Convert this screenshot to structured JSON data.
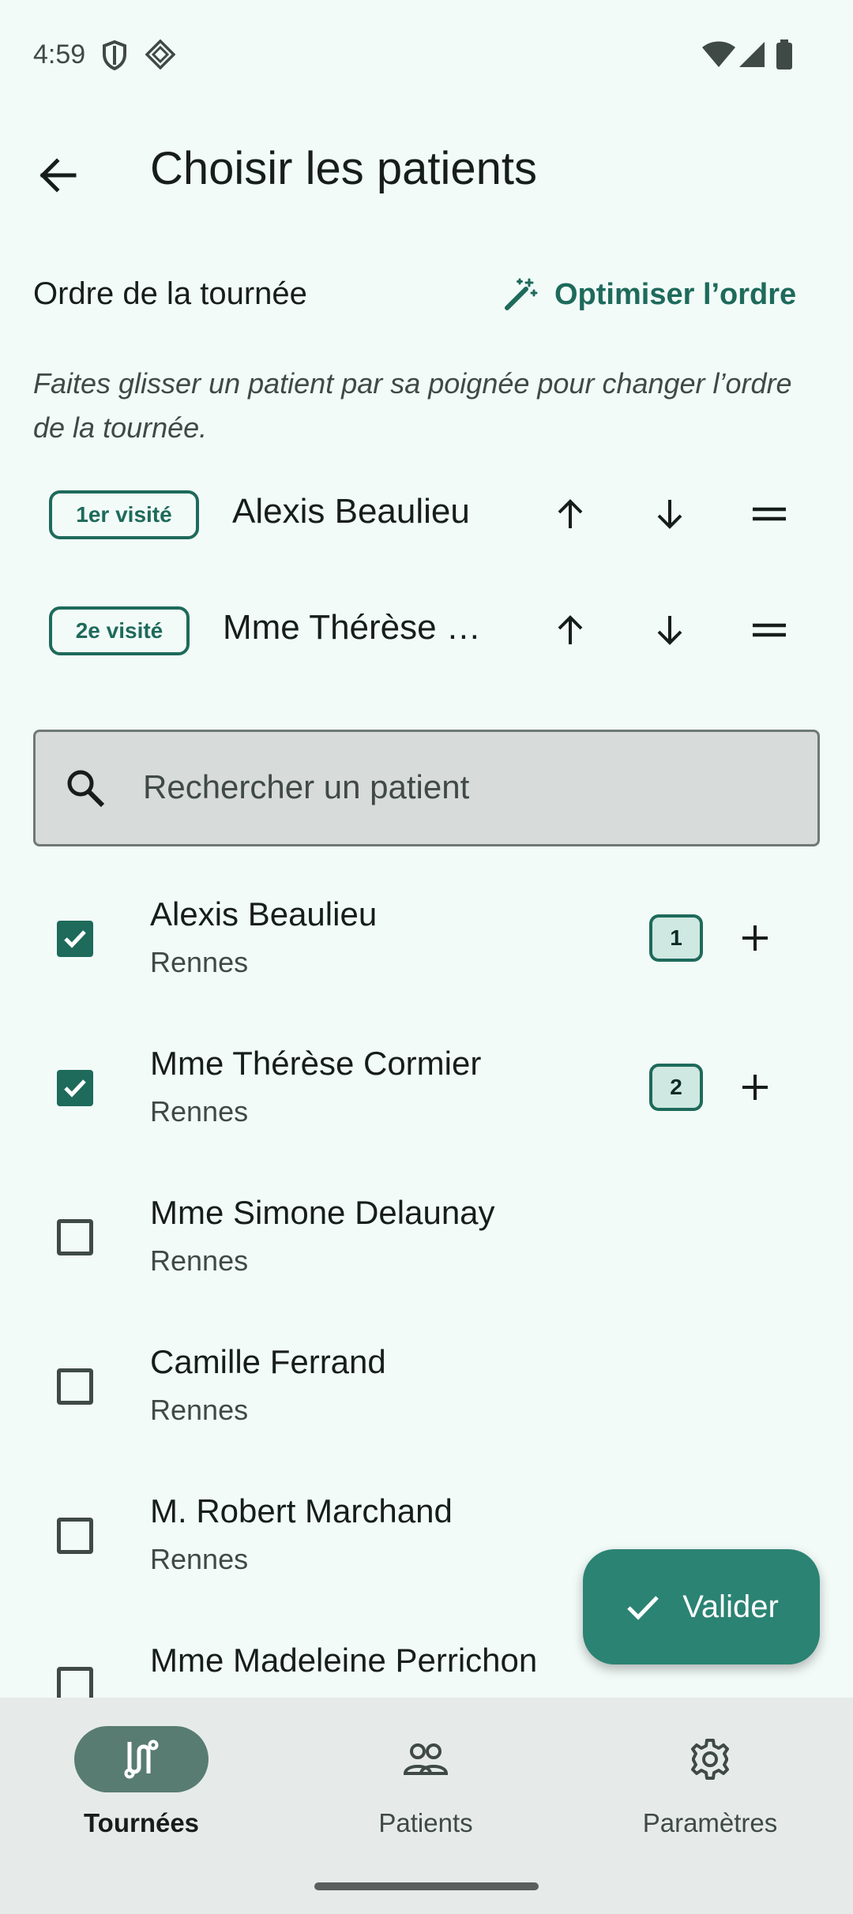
{
  "status_bar": {
    "time": "4:59"
  },
  "app_bar": {
    "title": "Choisir les patients"
  },
  "order_section": {
    "title": "Ordre de la tournée",
    "optimize_label": "Optimiser l’ordre",
    "hint": "Faites glisser un patient par sa poignée pour changer l’ordre de la tournée.",
    "items": [
      {
        "badge": "1er visité",
        "name": "Alexis Beaulieu"
      },
      {
        "badge": "2e visité",
        "name": "Mme Thérèse …"
      }
    ]
  },
  "search": {
    "placeholder": "Rechercher un patient"
  },
  "patients": [
    {
      "name": "Alexis Beaulieu",
      "city": "Rennes",
      "checked": true,
      "order": "1"
    },
    {
      "name": "Mme Thérèse Cormier",
      "city": "Rennes",
      "checked": true,
      "order": "2"
    },
    {
      "name": "Mme Simone Delaunay",
      "city": "Rennes",
      "checked": false
    },
    {
      "name": "Camille Ferrand",
      "city": "Rennes",
      "checked": false
    },
    {
      "name": "M. Robert Marchand",
      "city": "Rennes",
      "checked": false
    },
    {
      "name": "Mme Madeleine Perrichon",
      "city": "",
      "checked": false
    }
  ],
  "fab": {
    "label": "Valider"
  },
  "bottom_nav": [
    {
      "label": "Tournées",
      "icon": "route-icon",
      "active": true
    },
    {
      "label": "Patients",
      "icon": "people-icon",
      "active": false
    },
    {
      "label": "Paramètres",
      "icon": "gear-icon",
      "active": false
    }
  ],
  "colors": {
    "accent": "#1e6a5b",
    "fab": "#2b8373",
    "background": "#f2fbf8"
  }
}
